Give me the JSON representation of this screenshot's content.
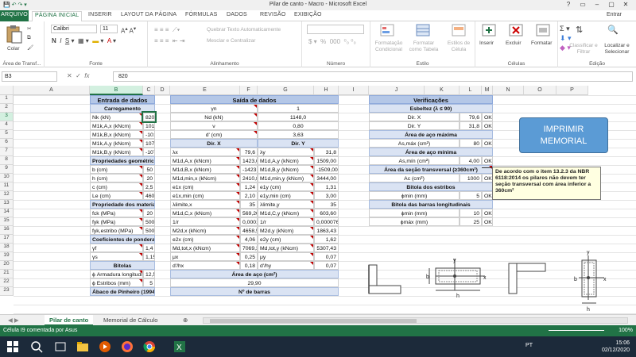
{
  "window": {
    "title": "Pilar de canto - Macro - Microsoft Excel",
    "user": "Entrar"
  },
  "ribbon_tabs": [
    "ARQUIVO",
    "PÁGINA INICIAL",
    "INSERIR",
    "LAYOUT DA PÁGINA",
    "FÓRMULAS",
    "DADOS",
    "REVISÃO",
    "EXIBIÇÃO"
  ],
  "ribbon": {
    "paste": "Colar",
    "clipboard_group": "Área de Transf...",
    "font_name": "Calibri",
    "font_size": "11",
    "font_group": "Fonte",
    "wrap_text": "Quebrar Texto Automaticamente",
    "merge_center": "Mesclar e Centralizar",
    "align_group": "Alinhamento",
    "number_group": "Número",
    "cond_format": "Formatação Condicional",
    "format_table": "Formatar como Tabela",
    "cell_styles": "Estilos de Célula",
    "style_group": "Estilo",
    "insert": "Inserir",
    "delete": "Excluir",
    "format": "Formatar",
    "cells_group": "Células",
    "sort_filter": "Classificar e Filtrar",
    "find_select": "Localizar e Selecionar",
    "edit_group": "Edição"
  },
  "formula_bar": {
    "name_box": "B3",
    "value": "820"
  },
  "columns": [
    "A",
    "B",
    "C",
    "D",
    "E",
    "F",
    "G",
    "H",
    "I",
    "J",
    "K",
    "L",
    "M",
    "N",
    "O",
    "P"
  ],
  "rows": [
    "1",
    "2",
    "3",
    "4",
    "5",
    "6",
    "7",
    "8",
    "9",
    "10",
    "11",
    "12",
    "13",
    "14",
    "15",
    "16",
    "17",
    "18",
    "19",
    "20",
    "21",
    "22",
    "23"
  ],
  "entrada": {
    "title": "Entrada de dados",
    "carregamento": "Carregamento",
    "rows": [
      [
        "Nk (kN)",
        "820"
      ],
      [
        "M1k,A,x (kNcm)",
        "1016,43"
      ],
      [
        "M1k,B,x (kNcm)",
        "-1016,43"
      ],
      [
        "M1k,A,y (kNcm)",
        "1077,86"
      ],
      [
        "M1k,B,y (kNcm)",
        "-1077,86"
      ]
    ],
    "geom_title": "Propriedades geométricas",
    "geom": [
      [
        "b (cm)",
        "50"
      ],
      [
        "h (cm)",
        "20"
      ],
      [
        "c (cm)",
        "2,5"
      ],
      [
        "Le (cm)",
        "460"
      ]
    ],
    "mat_title": "Propriedade dos materiais",
    "mat": [
      [
        "fck (MPa)",
        "20"
      ],
      [
        "fyk (MPa)",
        "500"
      ],
      [
        "fyk,estribo (MPa)",
        "500"
      ]
    ],
    "coef_title": "Coeficientes de ponderação",
    "coef": [
      [
        "γf",
        "1,4"
      ],
      [
        "γs",
        "1,15"
      ]
    ],
    "bit_title": "Bitolas",
    "bit": [
      [
        "ϕ Armadura longitudinal (mm)",
        "12,5"
      ],
      [
        "ϕ Estribos (mm)",
        "5"
      ]
    ],
    "abaco": "Ábaco de Pinheiro (1994)"
  },
  "saida": {
    "title": "Saída de dados",
    "top": [
      [
        "γn",
        "",
        "1"
      ],
      [
        "Nd (kN)",
        "",
        "1148,0"
      ],
      [
        "ν",
        "",
        "0,80"
      ],
      [
        "d' (cm)",
        "",
        "3,63"
      ]
    ],
    "dir_x": "Dir. X",
    "dir_y": "Dir. Y",
    "rows": [
      [
        "λx",
        "79,6",
        "λy",
        "31,8"
      ],
      [
        "M1d,A,x (kNcm)",
        "1423,00",
        "M1d,A,y (kNcm)",
        "1509,00"
      ],
      [
        "M1d,B,x (kNcm)",
        "-1423,00",
        "M1d,B,y (kNcm)",
        "-1509,00"
      ],
      [
        "M1d,min,x (kNcm)",
        "2410,80",
        "M1d,min,y (kNcm)",
        "3444,00"
      ],
      [
        "e1x (cm)",
        "1,24",
        "e1y (cm)",
        "1,31"
      ],
      [
        "e1x,min (cm)",
        "2,10",
        "e1y,min (cm)",
        "3,00"
      ],
      [
        "λlimite,x",
        "35",
        "λlimite,y",
        "35"
      ],
      [
        "M1d,C,x (kNcm)",
        "569,20",
        "M1d,C,y (kNcm)",
        "603,60"
      ],
      [
        "1/r",
        "0,0001918",
        "1/r",
        "0,0000767"
      ],
      [
        "M2d,x (kNcm)",
        "4658,58",
        "M2d,y (kNcm)",
        "1863,43"
      ],
      [
        "e2x (cm)",
        "4,06",
        "e2y (cm)",
        "1,62"
      ],
      [
        "Md,tot,x (kNcm)",
        "7069,38",
        "Md,tot,y (kNcm)",
        "5307,43"
      ],
      [
        "μx",
        "0,25",
        "μy",
        "0,07"
      ],
      [
        "d'/hx",
        "0,18",
        "d'/hy",
        "0,07"
      ]
    ],
    "area_title": "Área de aço (cm²)",
    "area_value": "29,90",
    "barras_title": "Nº de barras"
  },
  "verificacoes": {
    "title": "Verificações",
    "esbeltez": "Esbeltez (λ ≤ 90)",
    "esb_rows": [
      [
        "Dir. X",
        "79,6",
        "OK"
      ],
      [
        "Dir. Y",
        "31,8",
        "OK"
      ]
    ],
    "amax_title": "Área de aço máxima",
    "amax_row": [
      "As,máx (cm²)",
      "80",
      "OK"
    ],
    "amin_title": "Área de aço mínima",
    "amin_row": [
      "As,mín (cm²)",
      "4,00",
      "OK"
    ],
    "secao_title": "Área da seção transversal (≥360cm²)",
    "secao_row": [
      "Ac (cm²)",
      "1000",
      "OK"
    ],
    "estribos_title": "Bitola dos estribos",
    "estribos_row": [
      "ϕmin (mm)",
      "5",
      "OK"
    ],
    "long_title": "Bitola das barras longitudinais",
    "long_rows": [
      [
        "ϕmin (mm)",
        "10",
        "OK"
      ],
      [
        "ϕmáx (mm)",
        "25",
        "OK"
      ]
    ]
  },
  "print_button": "IMPRIMIR MEMORIAL",
  "comment_text": "De acordo com o item 13.2.3 da NBR 6118:2014 os pilares não devem ter seção transversal com área inferior a 360cm²",
  "diagrams": {
    "x_label": "x",
    "y_label": "y",
    "b_label": "b",
    "h_label": "h"
  },
  "sheet_tabs": [
    "Pilar de canto",
    "Memorial de Cálculo"
  ],
  "status": {
    "message": "Célula I9 comentada por Asus",
    "zoom": "100%"
  },
  "taskbar": {
    "lang": "PT",
    "time": "15:06",
    "date": "02/12/2020"
  },
  "colors": {
    "excel_green": "#217346",
    "header_blue": "#b4c7e7",
    "sub_blue": "#dae3f3",
    "button_blue": "#5b9bd5"
  }
}
